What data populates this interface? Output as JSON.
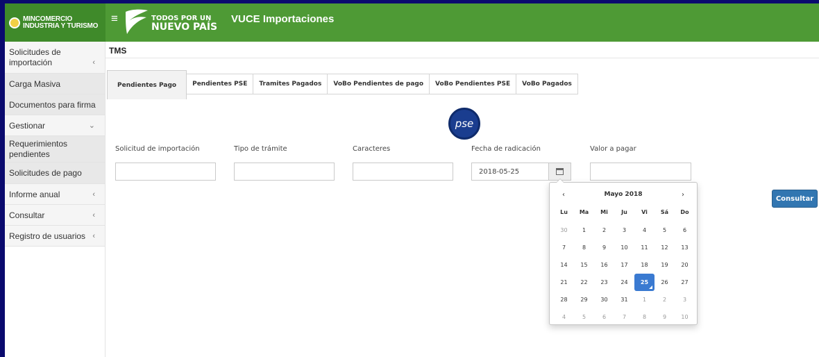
{
  "header": {
    "brand_line1": "MINCOMERCIO",
    "brand_line2": "INDUSTRIA Y TURISMO",
    "slogan_line1": "TODOS POR UN",
    "slogan_line2": "NUEVO PAÍS",
    "app_title": "VUCE Importaciones",
    "menu_icon": "hamburger-icon",
    "colors": {
      "header_green": "#4e9a35",
      "brand_green": "#3f8a2a"
    }
  },
  "sidebar": {
    "items": [
      {
        "label": "Solicitudes de importación",
        "chevron": "‹"
      },
      {
        "label": "Carga Masiva",
        "chevron": ""
      },
      {
        "label": "Documentos para firma",
        "chevron": ""
      },
      {
        "label": "Gestionar",
        "chevron": "⌄"
      },
      {
        "label": "Requerimientos pendientes",
        "chevron": ""
      },
      {
        "label": "Solicitudes de pago",
        "chevron": ""
      },
      {
        "label": "Informe anual",
        "chevron": "‹"
      },
      {
        "label": "Consultar",
        "chevron": "‹"
      },
      {
        "label": "Registro de usuarios",
        "chevron": "‹"
      }
    ]
  },
  "main": {
    "title": "TMS",
    "tabs": [
      {
        "label": "Pendientes Pago",
        "active": true
      },
      {
        "label": "Pendientes PSE",
        "active": false
      },
      {
        "label": "Tramites Pagados",
        "active": false
      },
      {
        "label": "VoBo Pendientes de pago",
        "active": false
      },
      {
        "label": "VoBo Pendientes PSE",
        "active": false
      },
      {
        "label": "VoBo Pagados",
        "active": false
      }
    ],
    "pse_logo_text": "pse",
    "fields": {
      "solicitud": {
        "label": "Solicitud de importación",
        "value": ""
      },
      "tipo": {
        "label": "Tipo de trámite",
        "value": ""
      },
      "caracteres": {
        "label": "Caracteres",
        "value": ""
      },
      "fecha": {
        "label": "Fecha de radicación",
        "value": "2018-05-25"
      },
      "valor": {
        "label": "Valor a pagar",
        "value": ""
      }
    },
    "consultar_label": "Consultar",
    "accent_color": "#3276b1"
  },
  "datepicker": {
    "prev": "‹",
    "next": "›",
    "month_label": "Mayo 2018",
    "weekdays": [
      "Lu",
      "Ma",
      "Mi",
      "Ju",
      "Vi",
      "Sá",
      "Do"
    ],
    "weeks": [
      [
        "30",
        "1",
        "2",
        "3",
        "4",
        "5",
        "6"
      ],
      [
        "7",
        "8",
        "9",
        "10",
        "11",
        "12",
        "13"
      ],
      [
        "14",
        "15",
        "16",
        "17",
        "18",
        "19",
        "20"
      ],
      [
        "21",
        "22",
        "23",
        "24",
        "25",
        "26",
        "27"
      ],
      [
        "28",
        "29",
        "30",
        "31",
        "1",
        "2",
        "3"
      ],
      [
        "4",
        "5",
        "6",
        "7",
        "8",
        "9",
        "10"
      ]
    ],
    "selected_day": "25",
    "selected_color": "#3a7ad1"
  }
}
